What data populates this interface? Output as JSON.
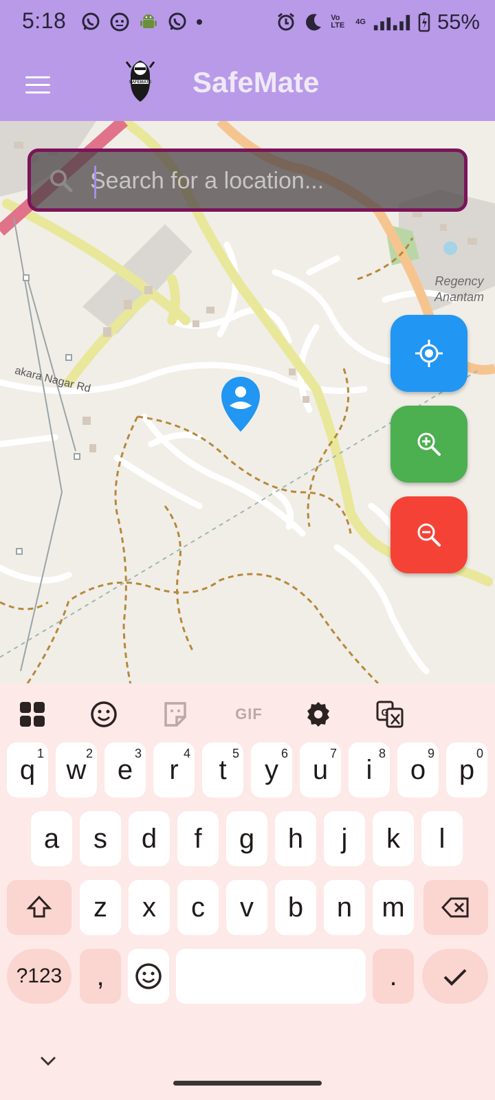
{
  "status_bar": {
    "time": "5:18",
    "notification_icons": [
      "whatsapp-icon",
      "game-controller-icon",
      "android-icon",
      "whatsapp-icon",
      "dot-icon"
    ],
    "system_icons": [
      "alarm-icon",
      "do-not-disturb-moon-icon",
      "volte-icon",
      "signal-icon",
      "battery-icon"
    ],
    "volte_text": "Vo LTE",
    "network_text": "4G",
    "battery": "55%"
  },
  "app_bar": {
    "title": "SafeMate",
    "logo_text": "SAFEMATE",
    "menu_icon": "hamburger-menu-icon",
    "bg_color": "#b89ae9"
  },
  "map": {
    "search": {
      "placeholder": "Search for a location...",
      "value": ""
    },
    "labels": {
      "regency_line1": "Regency",
      "regency_line2": "Anantam",
      "road": "akara Nagar Rd"
    },
    "buttons": {
      "locate": {
        "icon": "my-location-icon",
        "color": "#2196f3"
      },
      "zoom_in": {
        "icon": "zoom-in-icon",
        "color": "#4caf50"
      },
      "zoom_out": {
        "icon": "zoom-out-icon",
        "color": "#f44336"
      }
    }
  },
  "keyboard": {
    "toolbar": [
      "apps-grid-icon",
      "emoji-icon",
      "sticker-icon",
      "gif-icon",
      "settings-gear-icon",
      "translate-icon"
    ],
    "gif_label": "GIF",
    "row1": [
      {
        "k": "q",
        "h": "1"
      },
      {
        "k": "w",
        "h": "2"
      },
      {
        "k": "e",
        "h": "3"
      },
      {
        "k": "r",
        "h": "4"
      },
      {
        "k": "t",
        "h": "5"
      },
      {
        "k": "y",
        "h": "6"
      },
      {
        "k": "u",
        "h": "7"
      },
      {
        "k": "i",
        "h": "8"
      },
      {
        "k": "o",
        "h": "9"
      },
      {
        "k": "p",
        "h": "0"
      }
    ],
    "row2": [
      "a",
      "s",
      "d",
      "f",
      "g",
      "h",
      "j",
      "k",
      "l"
    ],
    "row3": [
      "z",
      "x",
      "c",
      "v",
      "b",
      "n",
      "m"
    ],
    "symbols_label": "?123",
    "comma": ",",
    "period": ".",
    "accent_color": "#fbd5cf"
  }
}
